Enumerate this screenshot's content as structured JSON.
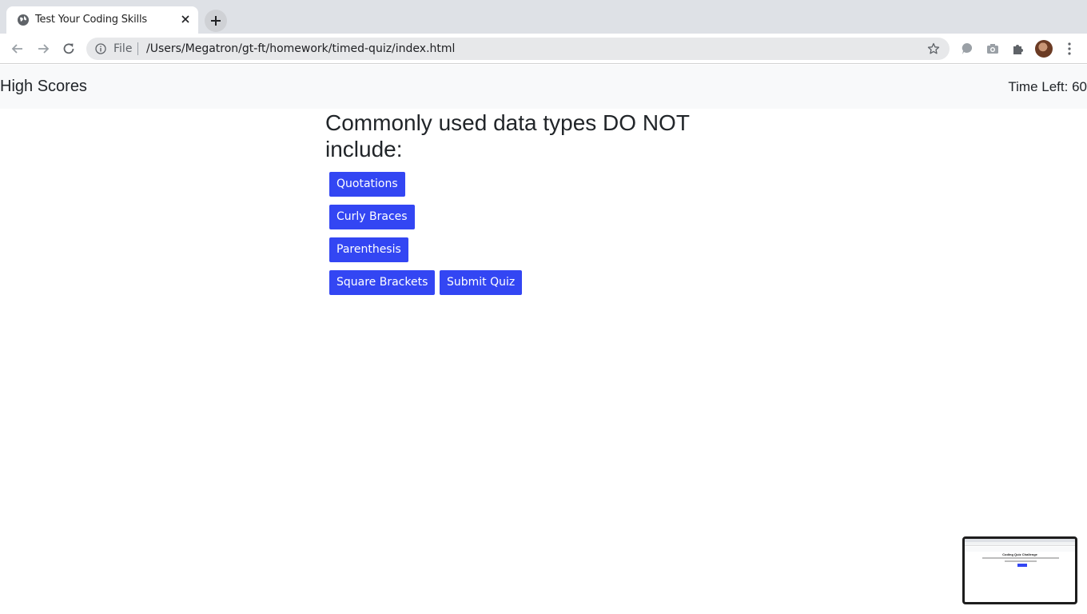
{
  "browser": {
    "tab_title": "Test Your Coding Skills",
    "address_prefix": "File",
    "url": "/Users/Megatron/gt-ft/homework/timed-quiz/index.html"
  },
  "header": {
    "high_scores": "High Scores",
    "timer_label": "Time Left: ",
    "timer_value": "60"
  },
  "quiz": {
    "question": "Commonly used data types DO NOT include:",
    "answers": [
      "Quotations",
      "Curly Braces",
      "Parenthesis",
      "Square Brackets"
    ],
    "submit_label": "Submit Quiz",
    "button_color": "#3346f3"
  },
  "thumbnail": {
    "title": "Coding Quiz Challenge"
  },
  "icons": [
    "globe-icon",
    "close-icon",
    "plus-icon",
    "back-arrow-icon",
    "forward-arrow-icon",
    "reload-icon",
    "info-icon",
    "star-icon",
    "chat-bubble-icon",
    "camera-icon",
    "puzzle-icon",
    "avatar",
    "kebab-menu-icon"
  ]
}
